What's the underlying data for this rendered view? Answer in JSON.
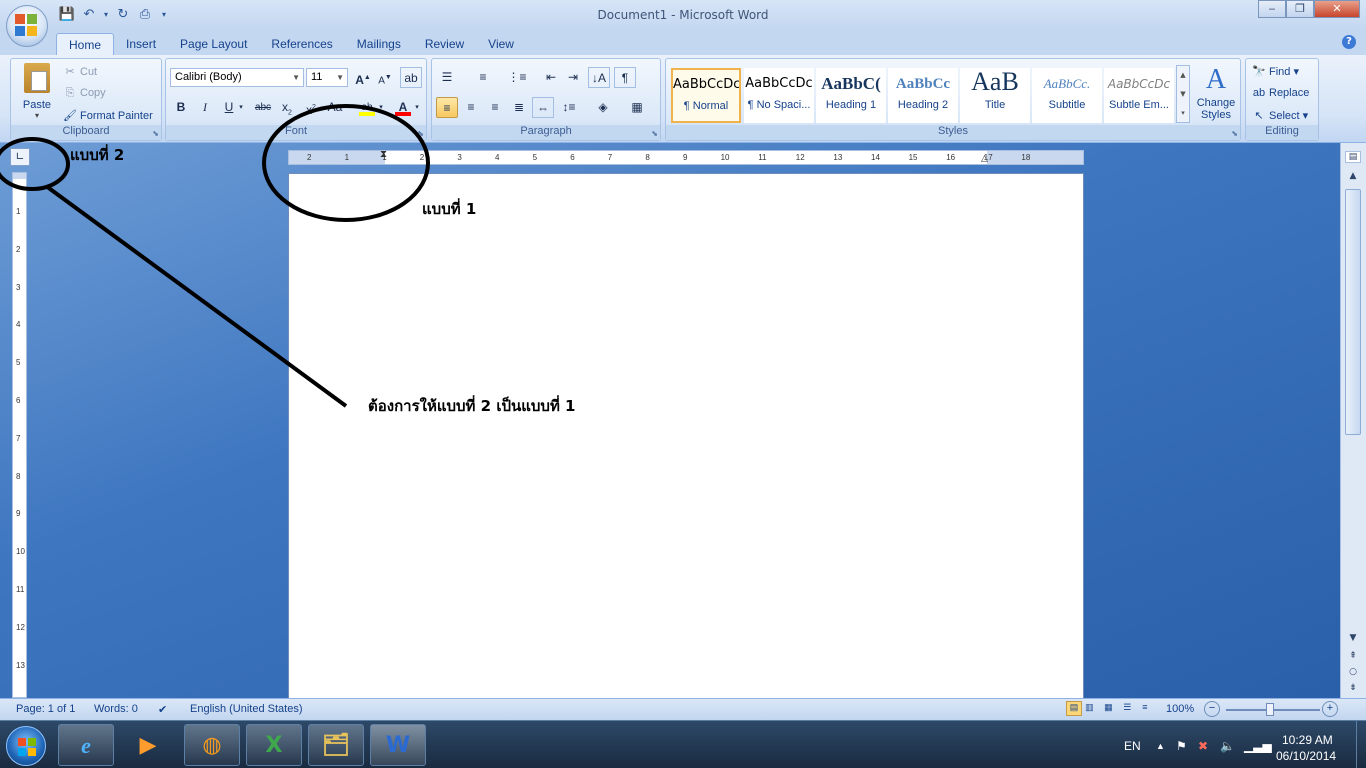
{
  "window": {
    "title": "Document1 - Microsoft Word",
    "minimize": "‒",
    "maximize": "❐",
    "close": "✕"
  },
  "tabs": [
    "Home",
    "Insert",
    "Page Layout",
    "References",
    "Mailings",
    "Review",
    "View"
  ],
  "clipboard": {
    "paste": "Paste",
    "cut": "Cut",
    "copy": "Copy",
    "format_painter": "Format Painter",
    "label": "Clipboard"
  },
  "font": {
    "name": "Calibri (Body)",
    "size": "11",
    "label": "Font"
  },
  "paragraph": {
    "label": "Paragraph"
  },
  "styles": {
    "label": "Styles",
    "items": [
      {
        "preview": "AaBbCcDc",
        "name": "¶ Normal"
      },
      {
        "preview": "AaBbCcDc",
        "name": "¶ No Spaci..."
      },
      {
        "preview": "AaBbC(",
        "name": "Heading 1"
      },
      {
        "preview": "AaBbCc",
        "name": "Heading 2"
      },
      {
        "preview": "AaB",
        "name": "Title"
      },
      {
        "preview": "AaBbCc.",
        "name": "Subtitle"
      },
      {
        "preview": "AaBbCcDc",
        "name": "Subtle Em..."
      }
    ],
    "change_styles": "Change Styles"
  },
  "editing": {
    "find": "Find",
    "replace": "Replace",
    "select": "Select",
    "label": "Editing"
  },
  "document": {
    "text_outside": "แบบที่ 2",
    "text_page": "แบบที่ 1",
    "annotation": "ต้องการให้แบบที่ 2 เป็นแบบที่ 1"
  },
  "ruler": {
    "h_ticks": [
      "2",
      "1",
      "1",
      "2",
      "3",
      "4",
      "5",
      "6",
      "7",
      "8",
      "9",
      "10",
      "11",
      "12",
      "13",
      "14",
      "15",
      "16",
      "17",
      "18"
    ],
    "v_ticks": [
      "1",
      "2",
      "3",
      "4",
      "5",
      "6",
      "7",
      "8",
      "9",
      "10",
      "11",
      "12",
      "13"
    ]
  },
  "statusbar": {
    "page": "Page: 1 of 1",
    "words": "Words: 0",
    "language": "English (United States)",
    "zoom": "100%"
  },
  "taskbar": {
    "lang": "EN",
    "time": "10:29 AM",
    "date": "06/10/2014"
  },
  "colors": {
    "accent": "#15428b",
    "ribbon_bg": "#d5e4f7",
    "doc_bg": "#3e76c0",
    "highlight": "#ffff00",
    "font_color": "#ff0000"
  }
}
